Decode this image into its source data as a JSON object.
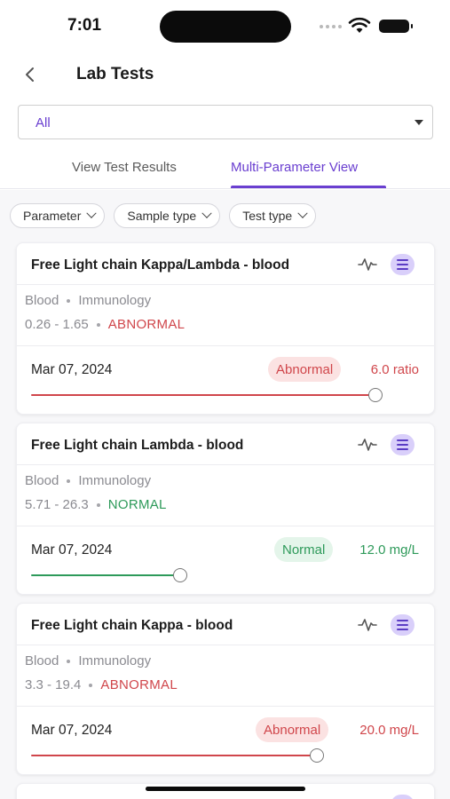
{
  "status_bar": {
    "time": "7:01"
  },
  "header": {
    "title": "Lab Tests"
  },
  "filter_dropdown": {
    "value": "All"
  },
  "tabs": [
    {
      "label": "View Test Results",
      "active": false
    },
    {
      "label": "Multi-Parameter View",
      "active": true
    }
  ],
  "filter_chips": [
    {
      "label": "Parameter"
    },
    {
      "label": "Sample type"
    },
    {
      "label": "Test type"
    }
  ],
  "colors": {
    "accent": "#6a3fd0",
    "abnormal": "#d0464b",
    "normal": "#2e9a5a"
  },
  "cards": [
    {
      "title": "Free Light chain Kappa/Lambda - blood",
      "sample": "Blood",
      "category": "Immunology",
      "range": "0.26 - 1.65",
      "status": "ABNORMAL",
      "date": "Mar 07, 2024",
      "badge": "Abnormal",
      "value": "6.0 ratio",
      "level": 1.0
    },
    {
      "title": "Free Light chain Lambda - blood",
      "sample": "Blood",
      "category": "Immunology",
      "range": "5.71 - 26.3",
      "status": "NORMAL",
      "date": "Mar 07, 2024",
      "badge": "Normal",
      "value": "12.0 mg/L",
      "level": 0.43
    },
    {
      "title": "Free Light chain Kappa - blood",
      "sample": "Blood",
      "category": "Immunology",
      "range": "3.3 - 19.4",
      "status": "ABNORMAL",
      "date": "Mar 07, 2024",
      "badge": "Abnormal",
      "value": "20.0 mg/L",
      "level": 0.83
    }
  ]
}
